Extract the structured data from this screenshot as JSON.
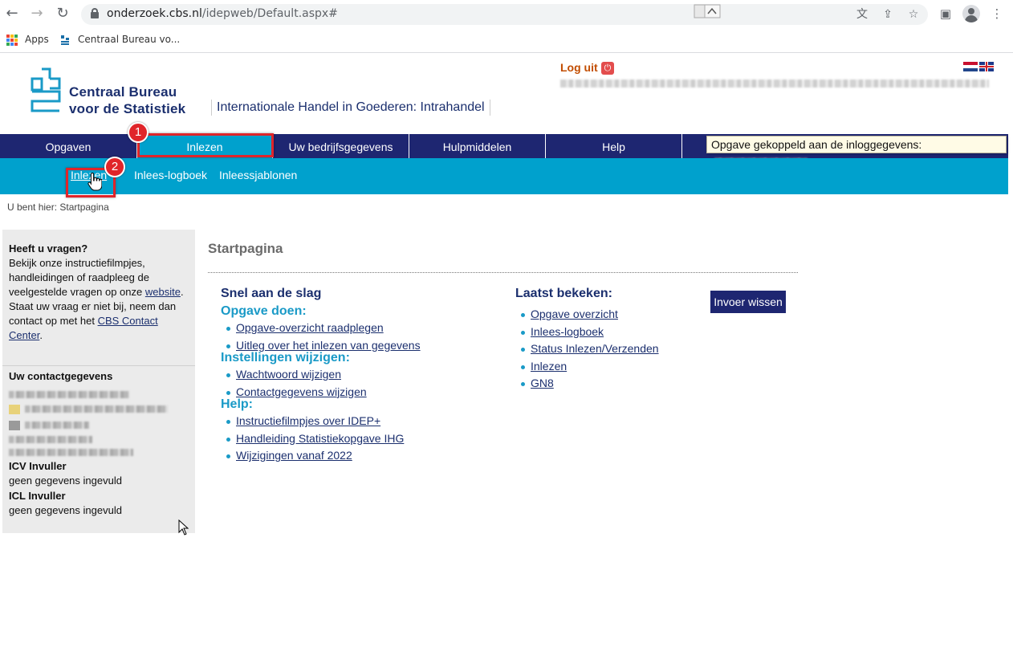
{
  "browser": {
    "url_host": "onderzoek.cbs.nl",
    "url_path": "/idepweb/Default.aspx#",
    "bookmarks": [
      {
        "label": "Apps"
      },
      {
        "label": "Centraal Bureau vo..."
      }
    ]
  },
  "header": {
    "logo_line1": "Centraal Bureau",
    "logo_line2": "voor de Statistiek",
    "app_title": "Internationale Handel in Goederen: Intrahandel",
    "logout_label": "Log uit"
  },
  "mainnav": {
    "items": [
      {
        "label": "Opgaven"
      },
      {
        "label": "Inlezen"
      },
      {
        "label": "Uw bedrijfsgegevens"
      },
      {
        "label": "Hulpmiddelen"
      },
      {
        "label": "Help"
      }
    ],
    "active": "Inlezen",
    "tooltip": "Opgave gekoppeld aan de inloggegevens:"
  },
  "subnav": {
    "items": [
      {
        "label": "Inlezen"
      },
      {
        "label": "Inlees-logboek"
      },
      {
        "label": "Inleessjablonen"
      }
    ]
  },
  "annotations": {
    "badge1": "1",
    "badge2": "2"
  },
  "breadcrumb": "U bent hier: Startpagina",
  "sidebar": {
    "questions_heading": "Heeft u vragen?",
    "questions_text1": "Bekijk onze instructiefilmpjes, handleidingen of raadpleeg de veelgestelde vragen op onze",
    "website_link": "website",
    "questions_text2": "Staat uw vraag er niet bij, neem dan contact op met het",
    "contact_center_link": "CBS Contact Center",
    "contact_heading": "Uw contactgegevens",
    "icv_label": "ICV Invuller",
    "icv_value": "geen gegevens ingevuld",
    "icl_label": "ICL Invuller",
    "icl_value": "geen gegevens ingevuld"
  },
  "main": {
    "title": "Startpagina",
    "quickstart_heading": "Snel aan de slag",
    "groups": [
      {
        "heading": "Opgave doen:",
        "links": [
          "Opgave-overzicht raadplegen",
          "Uitleg over het inlezen van gegevens"
        ]
      },
      {
        "heading": "Instellingen wijzigen:",
        "links": [
          "Wachtwoord wijzigen",
          "Contactgegevens wijzigen"
        ]
      },
      {
        "heading": "Help:",
        "links": [
          "Instructiefilmpjes over IDEP+",
          "Handleiding Statistiekopgave IHG",
          "Wijzigingen vanaf 2022"
        ]
      }
    ],
    "recent_heading": "Laatst bekeken:",
    "recent_links": [
      "Opgave overzicht",
      "Inlees-logboek",
      "Status Inlezen/Verzenden",
      "Inlezen",
      "GN8"
    ],
    "clear_button": "Invoer wissen"
  },
  "colors": {
    "nav_dark": "#1e2671",
    "nav_cyan": "#00a1cd",
    "annotation_red": "#e0252a"
  }
}
